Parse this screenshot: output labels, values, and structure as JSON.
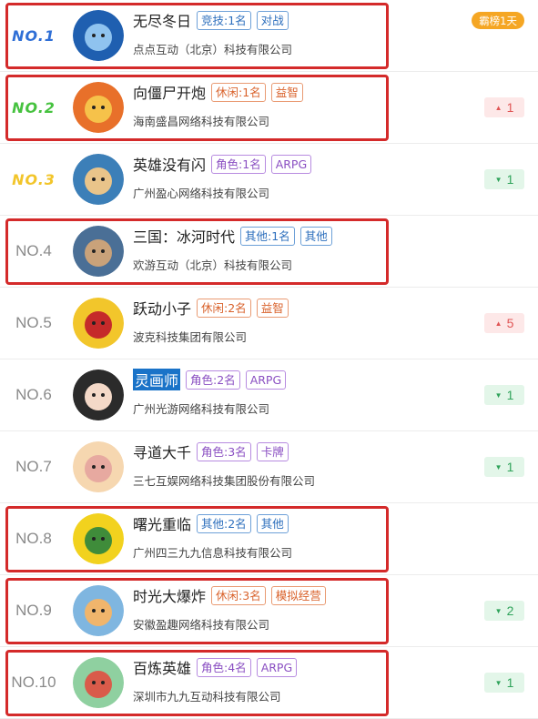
{
  "games": [
    {
      "rank": "NO.1",
      "name": "无尽冬日",
      "tags": [
        {
          "text": "竞技:1名",
          "color": "blue"
        },
        {
          "text": "对战",
          "color": "blue"
        }
      ],
      "company": "点点互动（北京）科技有限公司",
      "badge": {
        "kind": "pill",
        "text": "霸榜1天"
      },
      "highlighted": true,
      "selected": false,
      "icon": "globe-icon"
    },
    {
      "rank": "NO.2",
      "name": "向僵尸开炮",
      "tags": [
        {
          "text": "休闲:1名",
          "color": "orange"
        },
        {
          "text": "益智",
          "color": "orange"
        }
      ],
      "company": "海南盛昌网络科技有限公司",
      "badge": {
        "kind": "up",
        "value": "1"
      },
      "highlighted": true,
      "selected": false,
      "icon": "hero-icon"
    },
    {
      "rank": "NO.3",
      "name": "英雄没有闪",
      "tags": [
        {
          "text": "角色:1名",
          "color": "purple"
        },
        {
          "text": "ARPG",
          "color": "purple"
        }
      ],
      "company": "广州盈心网络科技有限公司",
      "badge": {
        "kind": "down",
        "value": "1"
      },
      "highlighted": false,
      "selected": false,
      "icon": "block-hero-icon"
    },
    {
      "rank": "NO.4",
      "name": "三国：冰河时代",
      "tags": [
        {
          "text": "其他:1名",
          "color": "blue"
        },
        {
          "text": "其他",
          "color": "blue"
        }
      ],
      "company": "欢游互动（北京）科技有限公司",
      "badge": null,
      "highlighted": true,
      "selected": false,
      "icon": "warrior-icon"
    },
    {
      "rank": "NO.5",
      "name": "跃动小子",
      "tags": [
        {
          "text": "休闲:2名",
          "color": "orange"
        },
        {
          "text": "益智",
          "color": "orange"
        }
      ],
      "company": "波克科技集团有限公司",
      "badge": {
        "kind": "up",
        "value": "5"
      },
      "highlighted": false,
      "selected": false,
      "icon": "helmet-icon"
    },
    {
      "rank": "NO.6",
      "name": "灵画师",
      "tags": [
        {
          "text": "角色:2名",
          "color": "purple"
        },
        {
          "text": "ARPG",
          "color": "purple"
        }
      ],
      "company": "广州光游网络科技有限公司",
      "badge": {
        "kind": "down",
        "value": "1"
      },
      "highlighted": false,
      "selected": true,
      "icon": "girl-icon"
    },
    {
      "rank": "NO.7",
      "name": "寻道大千",
      "tags": [
        {
          "text": "角色:3名",
          "color": "purple"
        },
        {
          "text": "卡牌",
          "color": "purple"
        }
      ],
      "company": "三七互娱网络科技集团股份有限公司",
      "badge": {
        "kind": "down",
        "value": "1"
      },
      "highlighted": false,
      "selected": false,
      "icon": "pig-icon"
    },
    {
      "rank": "NO.8",
      "name": "曙光重临",
      "tags": [
        {
          "text": "其他:2名",
          "color": "blue"
        },
        {
          "text": "其他",
          "color": "blue"
        }
      ],
      "company": "广州四三九九信息科技有限公司",
      "badge": null,
      "highlighted": true,
      "selected": false,
      "icon": "creature-icon"
    },
    {
      "rank": "NO.9",
      "name": "时光大爆炸",
      "tags": [
        {
          "text": "休闲:3名",
          "color": "orange"
        },
        {
          "text": "模拟经营",
          "color": "orange"
        }
      ],
      "company": "安徽盈趣网络科技有限公司",
      "badge": {
        "kind": "down",
        "value": "2"
      },
      "highlighted": true,
      "selected": false,
      "icon": "caveman-icon"
    },
    {
      "rank": "NO.10",
      "name": "百炼英雄",
      "tags": [
        {
          "text": "角色:4名",
          "color": "purple"
        },
        {
          "text": "ARPG",
          "color": "purple"
        }
      ],
      "company": "深圳市九九互动科技有限公司",
      "badge": {
        "kind": "down",
        "value": "1"
      },
      "highlighted": true,
      "selected": false,
      "icon": "heroes-group-icon"
    }
  ],
  "rank_colors": {
    "NO.1": "#2f6fd6",
    "NO.2": "#46c23f",
    "NO.3": "#f2c52a"
  },
  "icon_colors": {
    "globe-icon": [
      "#1f5fb0",
      "#8fc3ef"
    ],
    "hero-icon": [
      "#e8702a",
      "#f6c24a"
    ],
    "block-hero-icon": [
      "#3c7fb8",
      "#e9c48a"
    ],
    "warrior-icon": [
      "#4a6f96",
      "#c9a27a"
    ],
    "helmet-icon": [
      "#f2c62b",
      "#c52a2a"
    ],
    "girl-icon": [
      "#2b2b2b",
      "#f4d9c8"
    ],
    "pig-icon": [
      "#f6d7b0",
      "#e7a9a0"
    ],
    "creature-icon": [
      "#f2d21e",
      "#3f8c3a"
    ],
    "caveman-icon": [
      "#7fb6e0",
      "#f0b56c"
    ],
    "heroes-group-icon": [
      "#8fd0a0",
      "#d95b4a"
    ]
  }
}
